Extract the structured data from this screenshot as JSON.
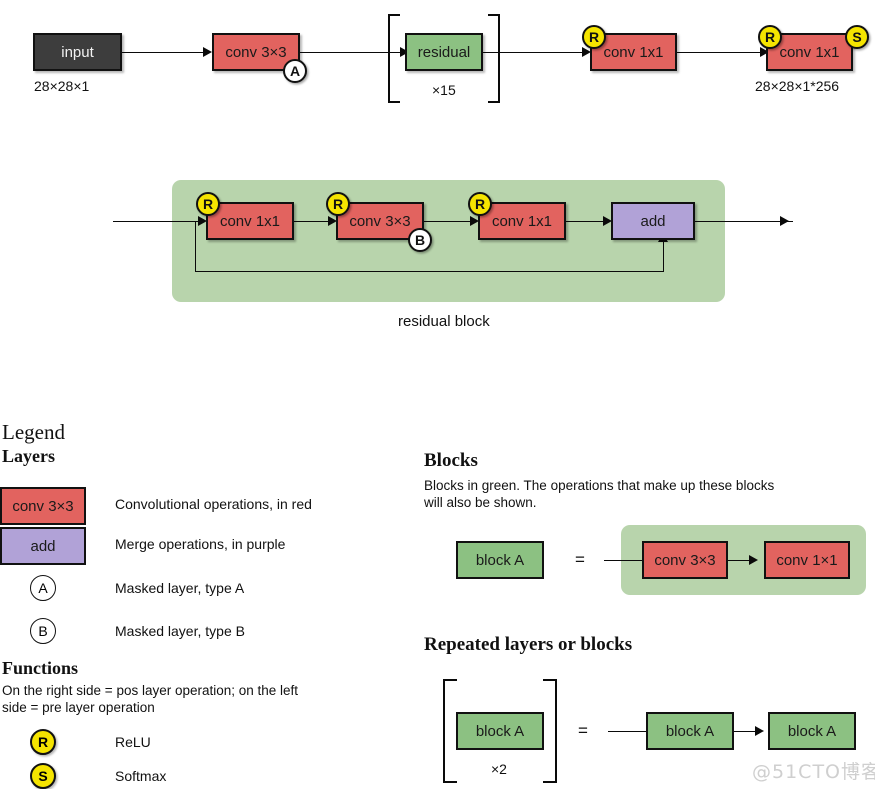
{
  "top_row": {
    "input": {
      "label": "input",
      "caption": "28×28×1"
    },
    "conv_a": {
      "label": "conv 3×3",
      "mask_badge": "A"
    },
    "residual": {
      "label": "residual",
      "repeat": "×15"
    },
    "conv_1x1_mid": {
      "label": "conv 1x1",
      "pre_badge": "R"
    },
    "conv_1x1_out": {
      "label": "conv 1x1",
      "pre_badge": "R",
      "post_badge": "S",
      "caption": "28×28×1*256"
    }
  },
  "residual_block": {
    "caption": "residual block",
    "nodes": [
      {
        "label": "conv 1x1",
        "pre_badge": "R"
      },
      {
        "label": "conv 3×3",
        "pre_badge": "R",
        "mask_badge": "B"
      },
      {
        "label": "conv 1x1",
        "pre_badge": "R"
      },
      {
        "label": "add"
      }
    ]
  },
  "legend": {
    "title": "Legend",
    "layers": {
      "heading": "Layers",
      "items": [
        {
          "swatch": "conv 3×3",
          "desc": "Convolutional operations, in red"
        },
        {
          "swatch": "add",
          "desc": "Merge operations, in purple"
        },
        {
          "swatch": "A",
          "desc": "Masked layer, type A"
        },
        {
          "swatch": "B",
          "desc": "Masked layer, type B"
        }
      ]
    },
    "functions": {
      "heading": "Functions",
      "description": "On the right side = pos layer operation; on the left side = pre layer operation",
      "items": [
        {
          "swatch": "R",
          "desc": "ReLU"
        },
        {
          "swatch": "S",
          "desc": "Softmax"
        }
      ]
    },
    "blocks": {
      "heading": "Blocks",
      "description": "Blocks in green. The operations that make up these blocks will also be shown.",
      "lhs": "block A",
      "equals": "=",
      "rhs": [
        "conv 3×3",
        "conv 1×1"
      ]
    },
    "repeated": {
      "heading": "Repeated layers or blocks",
      "lhs": "block A",
      "repeat": "×2",
      "equals": "=",
      "rhs": [
        "block A",
        "block A"
      ]
    }
  },
  "watermark": "@51CTO博客",
  "colors": {
    "conv_red": "#e2635f",
    "block_green": "#8cc182",
    "merge_purple": "#b1a2d7",
    "panel_green": "#b8d4ac",
    "function_yellow": "#f5e400",
    "input_dark": "#3d3d3d"
  }
}
